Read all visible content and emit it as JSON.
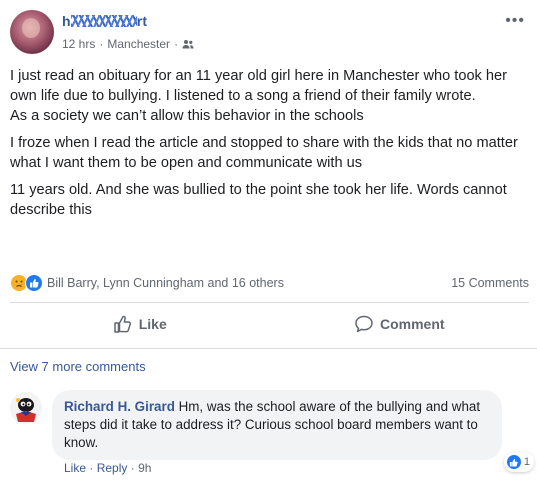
{
  "post": {
    "author": "h",
    "author_tail": "rt",
    "time": "12 hrs",
    "location": "Manchester",
    "paragraphs": [
      "I just read an obituary for an 11 year old girl here in Manchester who took her own life due to bullying. I listened to a song a friend of their family wrote.\nAs a society we can’t allow this behavior in the schools",
      "I froze when I read the article and stopped to share with the kids that no matter what I want them to be open and communicate with us",
      "11 years old. And she was bullied to the point she took her life. Words cannot describe this"
    ],
    "reactors": "Bill Barry, Lynn Cunningham and 16 others",
    "comments_count": "15 Comments"
  },
  "actions": {
    "like": "Like",
    "comment": "Comment"
  },
  "comments": {
    "view_more": "View 7 more comments",
    "item": {
      "author": "Richard H. Girard",
      "text": "Hm, was the school aware of the bullying and what steps did it take to address it? Curious school board members want to know.",
      "reaction_count": "1",
      "like": "Like",
      "reply": "Reply",
      "time": "9h"
    }
  },
  "colors": {
    "link": "#385898",
    "like_blue": "#2078f4",
    "sad_yellow": "#f7b125",
    "muted": "#606770"
  }
}
